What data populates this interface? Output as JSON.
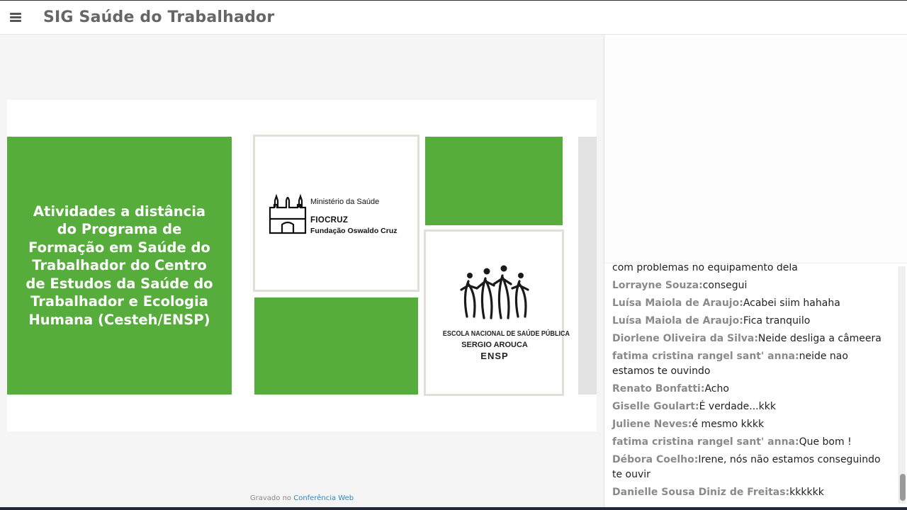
{
  "header": {
    "title": "SIG Saúde do Trabalhador",
    "menu_icon": "hamburger-menu-icon"
  },
  "slide": {
    "main_text": "Atividades a distância do Programa de Formação em Saúde do Trabalhador do Centro de Estudos da Saúde do Trabalhador e Ecologia Humana (Cesteh/ENSP)",
    "accent_color": "#56ad3c",
    "fiocruz_logo": {
      "ministry": "Ministério da Saúde",
      "name": "FIOCRUZ",
      "foundation": "Fundação Oswaldo Cruz"
    },
    "ensp_logo": {
      "line1": "ESCOLA NACIONAL DE SAÚDE PÚBLICA",
      "line2": "SERGIO AROUCA",
      "line3": "ENSP"
    }
  },
  "footer": {
    "recorded_prefix": "Gravado no",
    "recorded_link": "Conferência Web"
  },
  "chat": {
    "messages": [
      {
        "author": "",
        "text": "com problemas no equipamento dela"
      },
      {
        "author": "Lorrayne Souza:",
        "text": "consegui"
      },
      {
        "author": "Luísa Maiola de Araujo:",
        "text": "Acabei siim hahaha"
      },
      {
        "author": "Luísa Maiola de Araujo:",
        "text": "Fica tranquilo"
      },
      {
        "author": "Diorlene Oliveira da Silva:",
        "text": "Neide desliga a câmeera"
      },
      {
        "author": "fatima cristina rangel sant' anna:",
        "text": "neide nao estamos te ouvindo"
      },
      {
        "author": "Renato Bonfatti:",
        "text": "Acho"
      },
      {
        "author": "Giselle Goulart:",
        "text": "É verdade...kkk"
      },
      {
        "author": "Juliene Neves:",
        "text": "é mesmo kkkk"
      },
      {
        "author": "fatima cristina rangel sant' anna:",
        "text": "Que bom !"
      },
      {
        "author": "Débora Coelho:",
        "text": "Irene, nós não estamos conseguindo te ouvir"
      },
      {
        "author": "Danielle Sousa Diniz de Freitas:",
        "text": "kkkkkk"
      }
    ]
  }
}
